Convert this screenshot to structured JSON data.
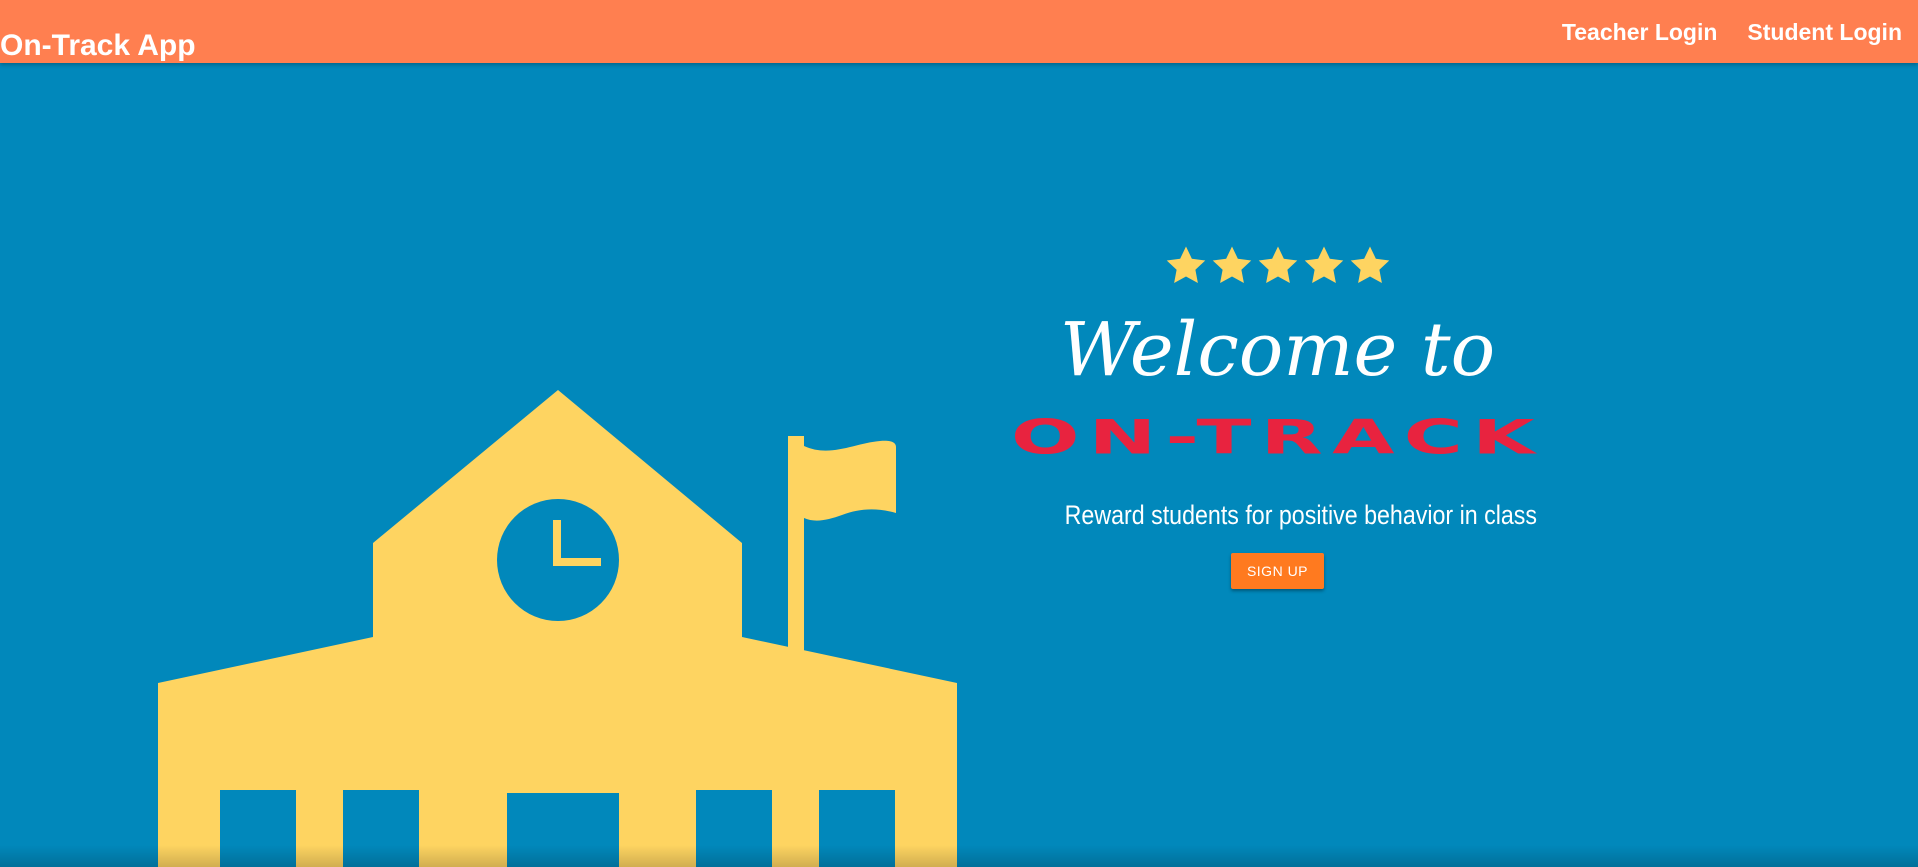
{
  "nav": {
    "brand": "On-Track App",
    "links": [
      {
        "label": "Teacher Login"
      },
      {
        "label": "Student Login"
      }
    ]
  },
  "hero": {
    "rating_stars": 5,
    "welcome": "Welcome to",
    "wordmark": "ON-TRACK",
    "tagline": "Reward students for positive behavior in class",
    "signup_label": "SIGN UP"
  },
  "illustration": {
    "icon": "school-building-icon",
    "features": [
      "clock-icon",
      "flag-icon"
    ]
  },
  "colors": {
    "navbar": "#ff7f50",
    "background": "#0188bb",
    "illustration": "#fed461",
    "stars": "#fed461",
    "wordmark": "#e8233f",
    "button": "#ff7a1f",
    "text": "#ffffff"
  }
}
